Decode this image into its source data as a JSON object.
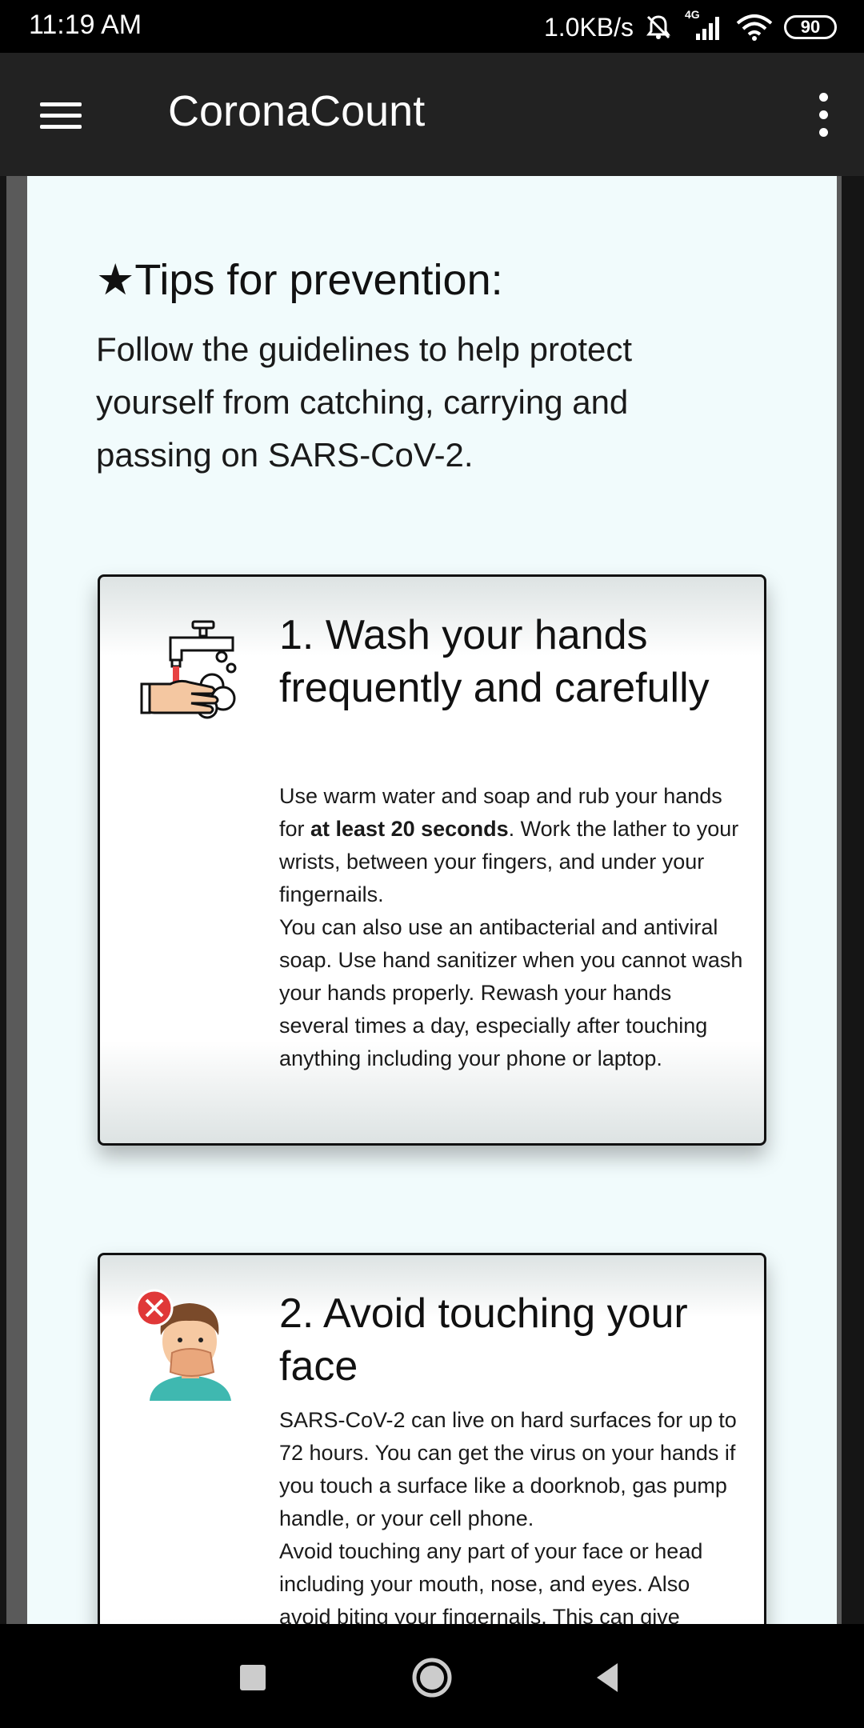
{
  "status_bar": {
    "time": "11:19 AM",
    "net_speed": "1.0KB/s",
    "network_type": "4G",
    "battery": "90",
    "icons": [
      "mute-icon",
      "signal-icon",
      "wifi-icon",
      "battery-icon"
    ]
  },
  "app_bar": {
    "title": "CoronaCount",
    "menu_icon": "hamburger-menu-icon",
    "overflow_icon": "more-vert-icon"
  },
  "content": {
    "heading": "★Tips for prevention:",
    "intro": "Follow the guidelines to help protect yourself from catching, carrying and passing on SARS-CoV-2.",
    "tips": [
      {
        "title": "1. Wash your hands frequently and carefully",
        "icon": "hand-washing-icon",
        "body_p1_before": "Use warm water and soap and rub your hands for ",
        "body_p1_bold": "at least 20 seconds",
        "body_p1_after": ". Work the lather to your wrists, between your fingers, and under your fingernails.",
        "body_p2": "You can also use an antibacterial and antiviral soap. Use hand sanitizer when you cannot wash your hands properly. Rewash your hands several times a day, especially after touching anything including your phone or laptop."
      },
      {
        "title": "2. Avoid touching your face",
        "icon": "no-face-touch-icon",
        "body_p1": "SARS-CoV-2 can live on hard surfaces for up to 72 hours. You can get the virus on your hands if you touch a surface like a doorknob, gas pump handle, or your cell phone.",
        "body_p2": "Avoid touching any part of your face or head including your mouth, nose, and eyes. Also avoid biting your fingernails. This can give"
      }
    ]
  },
  "nav_bar": {
    "buttons": [
      "recents-button",
      "home-button",
      "back-button"
    ]
  },
  "colors": {
    "app_bar_bg": "#222222",
    "page_bg": "#f1fbfc",
    "text": "#111111"
  }
}
